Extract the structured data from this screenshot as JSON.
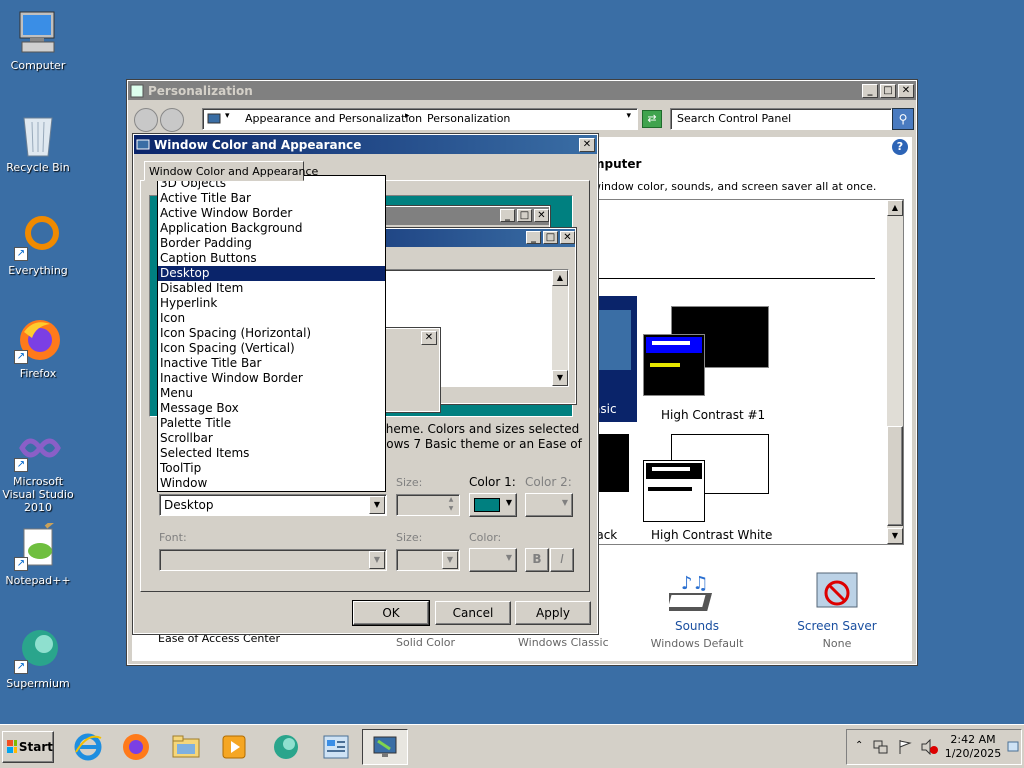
{
  "desktop": {
    "icons": [
      {
        "label": "Computer"
      },
      {
        "label": "Recycle Bin"
      },
      {
        "label": "Everything"
      },
      {
        "label": "Firefox"
      },
      {
        "label": "Microsoft Visual Studio 2010"
      },
      {
        "label": "Notepad++"
      },
      {
        "label": "Supermium"
      }
    ]
  },
  "personalization": {
    "title": "Personalization",
    "breadcrumb": [
      "Appearance and Personalization",
      "Personalization"
    ],
    "search_placeholder": "Search Control Panel",
    "heading_fragment": "mputer",
    "desc_fragment": "window color, sounds, and screen saver all at once.",
    "themes": [
      {
        "label": "asic"
      },
      {
        "label": "High Contrast #1"
      },
      {
        "label": "lack"
      },
      {
        "label": "High Contrast White"
      }
    ],
    "bottom_items": [
      {
        "label": "Ease of Access Center",
        "sub": ""
      },
      {
        "label": "",
        "sub": "Solid Color"
      },
      {
        "label": "",
        "sub": "Windows Classic"
      },
      {
        "label": "Sounds",
        "sub": "Windows Default"
      },
      {
        "label": "Screen Saver",
        "sub": "None"
      }
    ]
  },
  "dialog": {
    "title": "Window Color and Appearance",
    "tab": "Window Color and Appearance",
    "info_line1": "s theme.  Colors and sizes selected",
    "info_line2": "ndows 7 Basic theme or an Ease of",
    "item_label": "Item:",
    "size_label": "Size:",
    "color1_label": "Color 1:",
    "color2_label": "Color 2:",
    "font_label": "Font:",
    "font_size_label": "Size:",
    "font_color_label": "Color:",
    "bold_label": "B",
    "italic_label": "I",
    "item_value": "Desktop",
    "color1_value": "#008080",
    "ok": "OK",
    "cancel": "Cancel",
    "apply": "Apply",
    "dropdown_items": [
      "3D Objects",
      "Active Title Bar",
      "Active Window Border",
      "Application Background",
      "Border Padding",
      "Caption Buttons",
      "Desktop",
      "Disabled Item",
      "Hyperlink",
      "Icon",
      "Icon Spacing (Horizontal)",
      "Icon Spacing (Vertical)",
      "Inactive Title Bar",
      "Inactive Window Border",
      "Menu",
      "Message Box",
      "Palette Title",
      "Scrollbar",
      "Selected Items",
      "ToolTip",
      "Window"
    ],
    "selected_index": 6
  },
  "taskbar": {
    "start_label": "Start",
    "time": "2:42 AM",
    "date": "1/20/2025"
  },
  "colors": {
    "desktop_bg": "#3a6ea5",
    "selection": "#0a246a",
    "face": "#d4d0c8"
  }
}
